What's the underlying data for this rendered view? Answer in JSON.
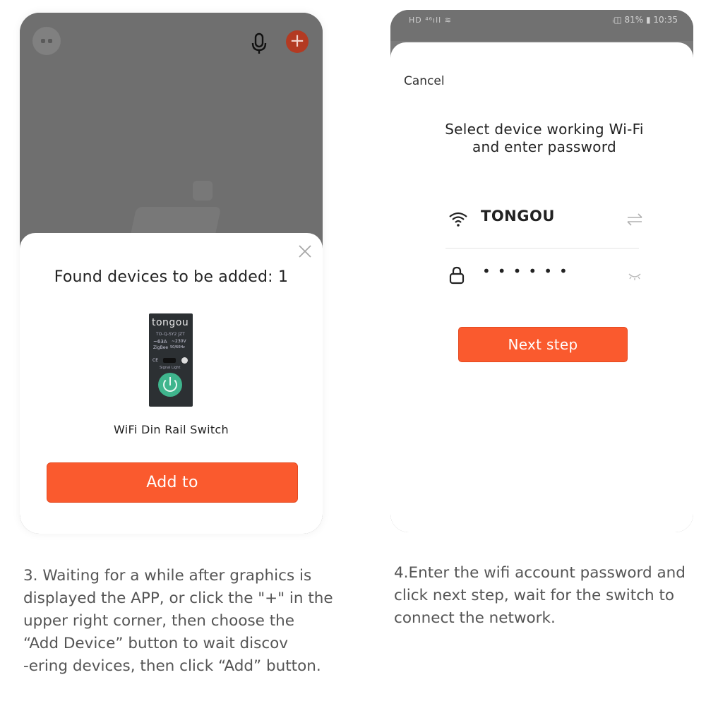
{
  "left_screen": {
    "dialog": {
      "title": "Found devices to be added: 1",
      "device": {
        "brand": "tongou",
        "model": "TO-Q-SY2 JZT",
        "current": "~63A",
        "voltage": "~230V",
        "protocol": "ZigBee",
        "frequency": "50/60Hz",
        "cert": "CE",
        "signal_label": "Signal Light"
      },
      "device_name": "WiFi Din Rail Switch",
      "add_button": "Add to"
    },
    "icons": [
      "robot-icon",
      "mic-icon",
      "plus-icon",
      "close-icon",
      "power-icon"
    ]
  },
  "caption_left": {
    "lines": [
      "3. Waiting for a while after graphics is",
      "displayed the APP, or click the \"+\" in the",
      "upper right corner, then choose the",
      "“Add Device” button to wait discov",
      "-ering devices, then click “Add” button."
    ]
  },
  "right_screen": {
    "status_bar": {
      "left": "HD ⁴⁶ıll ≋",
      "right": "ᵢ◫ 81% ▮ 10:35"
    },
    "cancel_label": "Cancel",
    "title_lines": [
      "Select device working Wi-Fi",
      "and enter password"
    ],
    "wifi_name": "TONGOU",
    "password_mask": "••••••",
    "next_button": "Next step",
    "icons": [
      "wifi-icon",
      "switch-network-icon",
      "lock-icon",
      "eye-closed-icon"
    ]
  },
  "caption_right": {
    "lines": [
      "4.Enter the wifi account password and",
      "click next step, wait for the switch to",
      "connect the network."
    ]
  },
  "colors": {
    "accent": "#fa5a2e",
    "overlay": "#6f6f6f",
    "power_button": "#3fb58d"
  }
}
